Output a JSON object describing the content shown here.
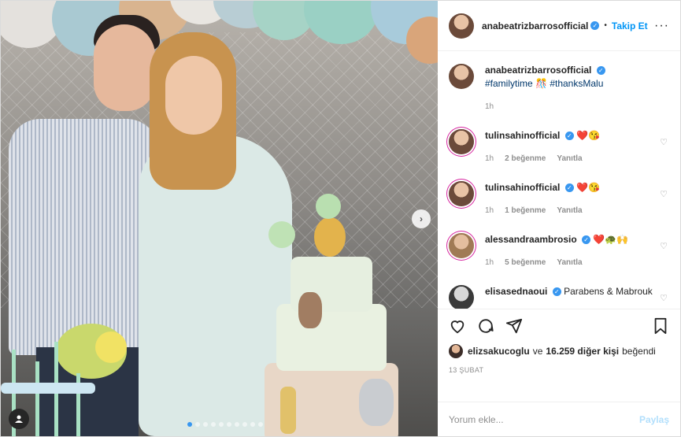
{
  "header": {
    "username": "anabeatrizbarrosofficial",
    "verified_mark": "✓",
    "separator": "•",
    "follow_label": "Takip Et",
    "more_label": "···"
  },
  "caption": {
    "username": "anabeatrizbarrosofficial",
    "hashtag1": "#familytime",
    "emoji": "🎊",
    "hashtag2": "#thanksMalu",
    "time": "1h"
  },
  "comments": [
    {
      "username": "tulinsahinofficial",
      "text": "❤️😘",
      "time": "1h",
      "likes": "2 beğenme",
      "reply": "Yanıtla"
    },
    {
      "username": "tulinsahinofficial",
      "text": "❤️😘",
      "time": "1h",
      "likes": "1 beğenme",
      "reply": "Yanıtla"
    },
    {
      "username": "alessandraambrosio",
      "text": "❤️🐢🙌",
      "time": "1h",
      "likes": "5 beğenme",
      "reply": "Yanıtla"
    },
    {
      "username": "elisasednaoui",
      "text": "Parabens & Mabrouk",
      "time": "",
      "likes": "",
      "reply": ""
    }
  ],
  "likes": {
    "user": "elizsakucoglu",
    "middle": "ve",
    "count": "16.259 diğer kişi",
    "suffix": "beğendi"
  },
  "date": "13 ŞUBAT",
  "comment_box": {
    "placeholder": "Yorum ekle...",
    "post_label": "Paylaş"
  },
  "media": {
    "next_glyph": "›",
    "carousel_count": 10,
    "carousel_active_index": 0
  },
  "icons": {
    "like": "heart-icon",
    "comment": "comment-icon",
    "share": "share-icon",
    "save": "bookmark-icon",
    "comment_like": "heart-icon",
    "user_tag": "user-tag-icon"
  },
  "colors": {
    "link_blue": "#0095f6",
    "hashtag": "#00376b",
    "muted": "#8e8e8e",
    "post_disabled": "#b2dffc"
  }
}
